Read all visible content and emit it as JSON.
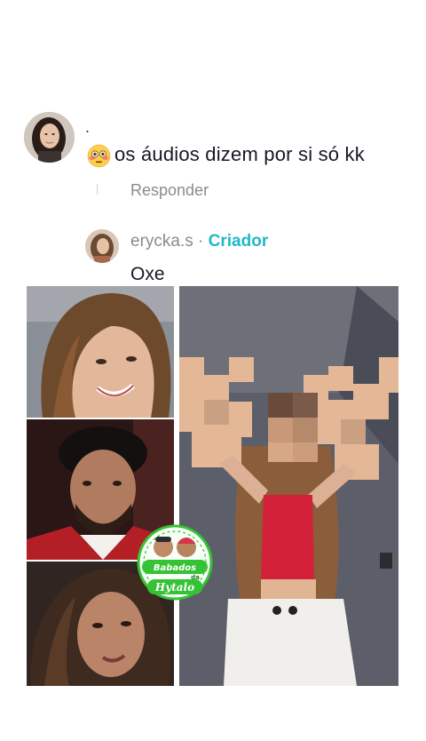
{
  "comment": {
    "username": ".",
    "emoji": "flushed-face",
    "text": "os áudios dizem por si só kk",
    "reply_label": "Responder"
  },
  "reply": {
    "username": "erycka.s",
    "separator": " · ",
    "creator_label": "Criador",
    "text": "Oxe"
  },
  "collage": {
    "logo_text_top": "Babados",
    "logo_text_mid": "da",
    "logo_text_bottom": "Hytalo"
  },
  "colors": {
    "creator": "#20b8c8",
    "muted": "#8a8b91",
    "text": "#161823",
    "logo_green": "#35c234"
  }
}
